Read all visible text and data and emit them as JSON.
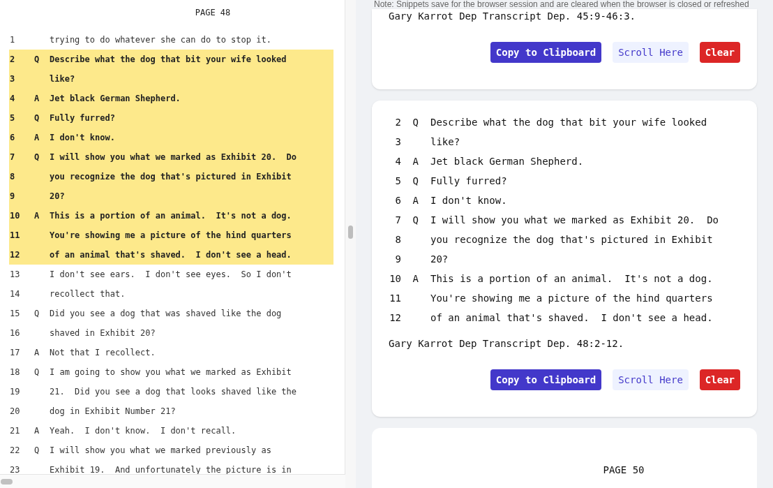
{
  "transcript": {
    "page": "PAGE 48",
    "lines": [
      {
        "number": "1",
        "text": "trying to do whatever she can do to stop it.",
        "selected": false
      },
      {
        "number": "2",
        "speaker": "Q",
        "text": "Describe what the dog that bit your wife looked",
        "selected": true
      },
      {
        "number": "3",
        "text": "like?",
        "selected": true
      },
      {
        "number": "4",
        "speaker": "A",
        "text": "Jet black German Shepherd.",
        "selected": true
      },
      {
        "number": "5",
        "speaker": "Q",
        "text": "Fully furred?",
        "selected": true
      },
      {
        "number": "6",
        "speaker": "A",
        "text": "I don't know.",
        "selected": true
      },
      {
        "number": "7",
        "speaker": "Q",
        "text": "I will show you what we marked as Exhibit 20.  Do",
        "selected": true
      },
      {
        "number": "8",
        "text": "you recognize the dog that's pictured in Exhibit",
        "selected": true
      },
      {
        "number": "9",
        "text": "20?",
        "selected": true
      },
      {
        "number": "10",
        "speaker": "A",
        "text": "This is a portion of an animal.  It's not a dog.",
        "selected": true
      },
      {
        "number": "11",
        "text": "You're showing me a picture of the hind quarters",
        "selected": true
      },
      {
        "number": "12",
        "text": "of an animal that's shaved.  I don't see a head.",
        "selected": true
      },
      {
        "number": "13",
        "text": "I don't see ears.  I don't see eyes.  So I don't",
        "selected": false
      },
      {
        "number": "14",
        "text": "recollect that.",
        "selected": false
      },
      {
        "number": "15",
        "speaker": "Q",
        "text": "Did you see a dog that was shaved like the dog",
        "selected": false
      },
      {
        "number": "16",
        "text": "shaved in Exhibit 20?",
        "selected": false
      },
      {
        "number": "17",
        "speaker": "A",
        "text": "Not that I recollect.",
        "selected": false
      },
      {
        "number": "18",
        "speaker": "Q",
        "text": "I am going to show you what we marked as Exhibit",
        "selected": false
      },
      {
        "number": "19",
        "text": "21.  Did you see a dog that looks shaved like the",
        "selected": false
      },
      {
        "number": "20",
        "text": "dog in Exhibit Number 21?",
        "selected": false
      },
      {
        "number": "21",
        "speaker": "A",
        "text": "Yeah.  I don't know.  I don't recall.",
        "selected": false
      },
      {
        "number": "22",
        "speaker": "Q",
        "text": "I will show you what we marked previously as",
        "selected": false
      },
      {
        "number": "23",
        "text": "Exhibit 19.  And unfortunately the picture is in",
        "selected": false
      }
    ]
  },
  "note": "Note: Snippets save for the browser session and are cleared when the browser is closed or refreshed",
  "snippets": [
    {
      "citation": "Gary Karrot Dep Transcript Dep. 45:9-46:3.",
      "buttons": [
        {
          "label": "Copy to Clipboard",
          "kind": "primary"
        },
        {
          "label": "Scroll Here",
          "kind": "secondary"
        },
        {
          "label": "Clear",
          "kind": "danger"
        }
      ]
    },
    {
      "lines": [
        {
          "number": "2",
          "speaker": "Q",
          "text": "Describe what the dog that bit your wife looked"
        },
        {
          "number": "3",
          "text": "like?"
        },
        {
          "number": "4",
          "speaker": "A",
          "text": "Jet black German Shepherd."
        },
        {
          "number": "5",
          "speaker": "Q",
          "text": "Fully furred?"
        },
        {
          "number": "6",
          "speaker": "A",
          "text": "I don't know."
        },
        {
          "number": "7",
          "speaker": "Q",
          "text": "I will show you what we marked as Exhibit 20.  Do"
        },
        {
          "number": "8",
          "text": "you recognize the dog that's pictured in Exhibit"
        },
        {
          "number": "9",
          "text": "20?"
        },
        {
          "number": "10",
          "speaker": "A",
          "text": "This is a portion of an animal.  It's not a dog."
        },
        {
          "number": "11",
          "text": "You're showing me a picture of the hind quarters"
        },
        {
          "number": "12",
          "text": "of an animal that's shaved.  I don't see a head."
        }
      ],
      "citation": "Gary Karrot Dep Transcript Dep. 48:2-12.",
      "buttons": [
        {
          "label": "Copy to Clipboard",
          "kind": "primary"
        },
        {
          "label": "Scroll Here",
          "kind": "secondary"
        },
        {
          "label": "Clear",
          "kind": "danger"
        }
      ]
    }
  ],
  "next_page": {
    "title": "PAGE 50"
  }
}
